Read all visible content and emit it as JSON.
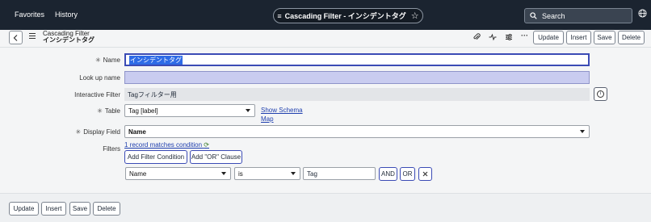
{
  "nav": {
    "favorites": "Favorites",
    "history": "History",
    "title": "Cascading Filter - インシデントタグ",
    "search_label": "Search"
  },
  "header": {
    "title": "Cascading Filter",
    "subtitle": "インシデントタグ",
    "buttons": {
      "update": "Update",
      "insert": "Insert",
      "save": "Save",
      "delete": "Delete"
    }
  },
  "form": {
    "name": {
      "label": "Name",
      "value": "インシデントタグ"
    },
    "lookup_name": {
      "label": "Look up name",
      "value": ""
    },
    "interactive_filter": {
      "label": "Interactive Filter",
      "value": "Tagフィルター用"
    },
    "table": {
      "label": "Table",
      "value": "Tag [label]",
      "show_schema": "Show Schema",
      "map": "Map"
    },
    "display_field": {
      "label": "Display Field",
      "value": "Name"
    },
    "filters": {
      "label": "Filters",
      "summary": "1 record matches condition",
      "add_condition": "Add Filter Condition",
      "add_or": "Add \"OR\" Clause",
      "condition": {
        "field": "Name",
        "operator": "is",
        "value": "Tag"
      },
      "and_label": "AND",
      "or_label": "OR"
    }
  },
  "footer": {
    "update": "Update",
    "insert": "Insert",
    "save": "Save",
    "delete": "Delete"
  }
}
